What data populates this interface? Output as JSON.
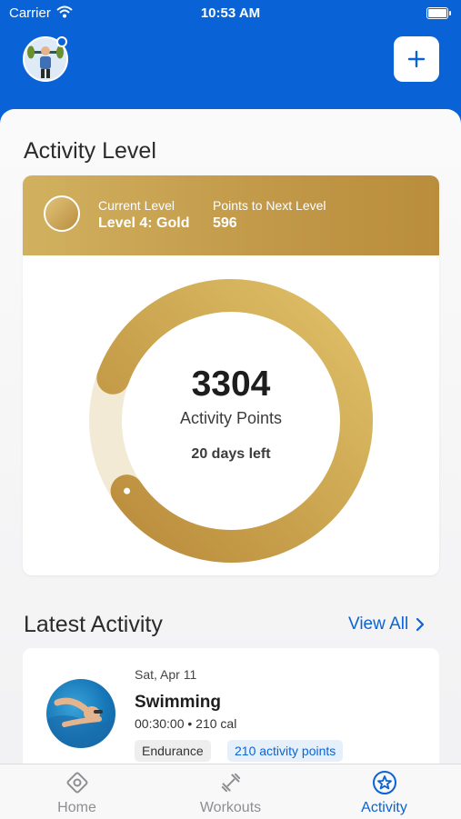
{
  "status_bar": {
    "carrier": "Carrier",
    "time": "10:53 AM"
  },
  "header": {
    "avatar": "user-avatar",
    "add_icon": "plus-icon"
  },
  "activity_level": {
    "title": "Activity Level",
    "current_level_label": "Current Level",
    "current_level_value": "Level 4: Gold",
    "next_level_label": "Points to Next Level",
    "next_level_value": "596",
    "points_value": "3304",
    "points_label": "Activity Points",
    "days_left": "20 days left",
    "progress_fraction": 0.85,
    "accent_gold": "#c29a4a"
  },
  "latest_activity": {
    "title": "Latest Activity",
    "view_all": "View All",
    "items": [
      {
        "date": "Sat, Apr 11",
        "name": "Swimming",
        "meta": "00:30:00 • 210 cal",
        "tags": [
          "Endurance",
          "210 activity points"
        ]
      }
    ]
  },
  "tabs": [
    {
      "label": "Home",
      "icon": "home-icon",
      "active": false
    },
    {
      "label": "Workouts",
      "icon": "dumbbell-icon",
      "active": false
    },
    {
      "label": "Activity",
      "icon": "star-badge-icon",
      "active": true
    }
  ],
  "colors": {
    "primary": "#0a63d6",
    "inactive": "#8e8e93"
  }
}
